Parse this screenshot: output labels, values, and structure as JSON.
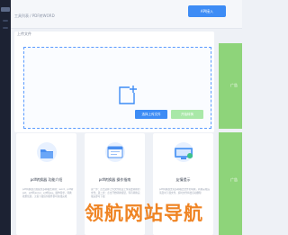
{
  "breadcrumb": "工具列表 / PDF转WORD",
  "header": {
    "api_button": "API接入"
  },
  "upload": {
    "title": "上传文件",
    "choose_button": "选择上传文件",
    "start_button": "开始转换"
  },
  "ads": {
    "label": "广告"
  },
  "cards": [
    {
      "title": "pdf转换器 功能介绍",
      "desc": "pdf转换器为您提供多种格式转换：word、pdf转ppt、pdf转excel、pdf转jpg，操作简单，转换效果优质，无需下载任何软件即可在线完成"
    },
    {
      "title": "pdf转换器 操作指南",
      "desc": "第一步：点击选择上传文件按钮上传需要转换的文件；第二步：点击开始转换按钮，等待转换完成后即可下载"
    },
    {
      "title": "友情提示",
      "desc": "pdf转换器支持多种格式文件的转换，转换完成后请及时下载文件，超时文件将会自动删除"
    }
  ],
  "watermark": "领航网站导航",
  "colors": {
    "accent": "#3d8cf5",
    "start_button": "#a9e8a8",
    "ad_green": "#8ed47a",
    "watermark": "#ee7a12",
    "sidebar": "#1c2233"
  }
}
